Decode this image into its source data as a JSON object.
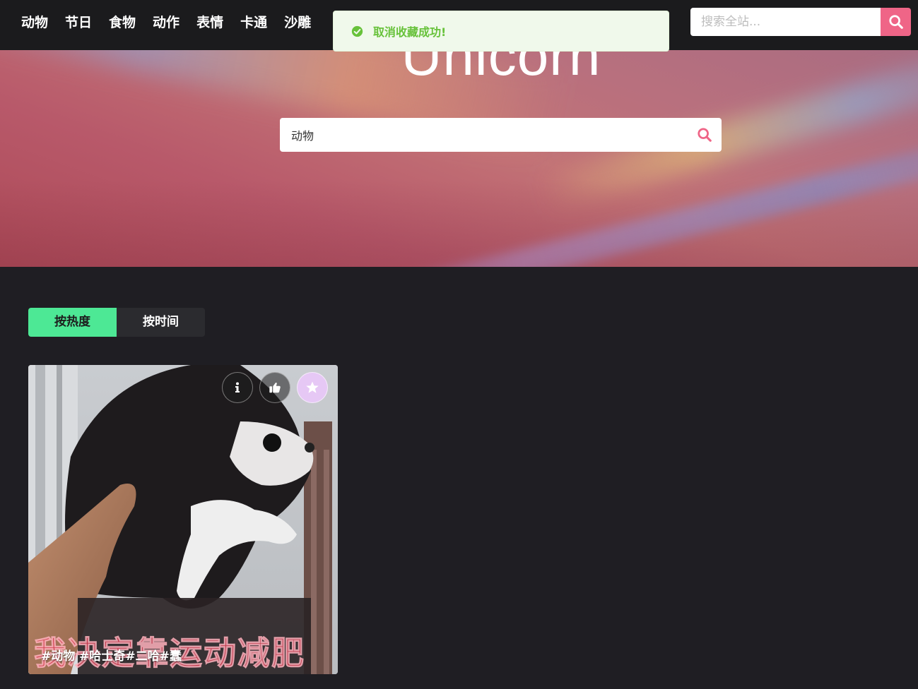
{
  "nav": {
    "items": [
      {
        "label": "动物"
      },
      {
        "label": "节日"
      },
      {
        "label": "食物"
      },
      {
        "label": "动作"
      },
      {
        "label": "表情"
      },
      {
        "label": "卡通"
      },
      {
        "label": "沙雕"
      }
    ]
  },
  "site_search": {
    "placeholder": "搜索全站...",
    "icon": "search-icon"
  },
  "toast": {
    "message": "取消收藏成功!",
    "icon": "check-circle-icon",
    "color": "#67c23a"
  },
  "hero": {
    "title": "Unicorn",
    "search": {
      "value": "动物",
      "icon": "search-icon"
    }
  },
  "sort_tabs": {
    "items": [
      {
        "label": "按热度",
        "active": true
      },
      {
        "label": "按时间",
        "active": false
      }
    ]
  },
  "card": {
    "tags": "#动物 #哈士奇#二哈#蠢",
    "caption": "我决定靠运动减肥",
    "actions": [
      {
        "name": "info-icon"
      },
      {
        "name": "thumbs-up-icon"
      },
      {
        "name": "star-icon"
      }
    ]
  },
  "colors": {
    "accent_pink": "#ef6587",
    "accent_green": "#4de895",
    "background": "#1f1e23",
    "favorite_button": "#e6c8f5"
  }
}
